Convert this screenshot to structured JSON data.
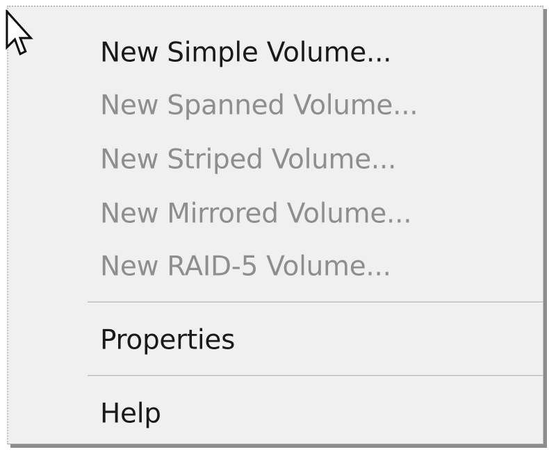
{
  "context_menu": {
    "items": [
      {
        "label": "New Simple Volume...",
        "enabled": true
      },
      {
        "label": "New Spanned Volume...",
        "enabled": false
      },
      {
        "label": "New Striped Volume...",
        "enabled": false
      },
      {
        "label": "New Mirrored Volume...",
        "enabled": false
      },
      {
        "label": "New RAID-5 Volume...",
        "enabled": false
      },
      {
        "label": "Properties",
        "enabled": true
      },
      {
        "label": "Help",
        "enabled": true
      }
    ]
  },
  "cursor": {
    "icon": "mouse-pointer-icon"
  }
}
